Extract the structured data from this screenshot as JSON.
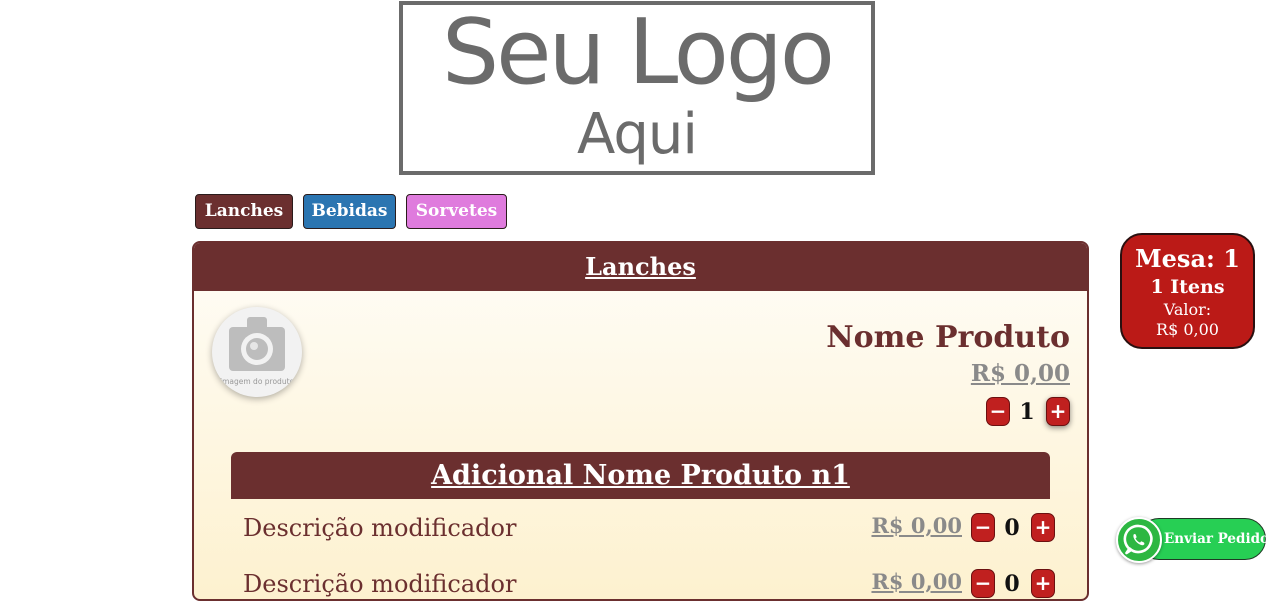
{
  "logo": {
    "line1": "Seu Logo",
    "line2": "Aqui"
  },
  "tabs": [
    {
      "label": "Lanches",
      "color": "#6b2f2f"
    },
    {
      "label": "Bebidas",
      "color": "#2b75b1"
    },
    {
      "label": "Sorvetes",
      "color": "#df7bdd"
    }
  ],
  "section": {
    "title": "Lanches"
  },
  "product": {
    "image_caption": "Imagem do produto",
    "name": "Nome Produto",
    "price": "R$ 0,00",
    "quantity": "1"
  },
  "addon": {
    "title": "Adicional Nome Produto n1",
    "modifiers": [
      {
        "description": "Descrição modificador",
        "price": "R$ 0,00",
        "quantity": "0"
      },
      {
        "description": "Descrição modificador",
        "price": "R$ 0,00",
        "quantity": "0"
      }
    ]
  },
  "mesa": {
    "title": "Mesa: 1",
    "items": "1 Itens",
    "value_label": "Valor:",
    "value": "R$ 0,00"
  },
  "whatsapp": {
    "label": "Enviar Pedido"
  },
  "controls": {
    "minus": "−",
    "plus": "+"
  },
  "colors": {
    "brand": "#6b2f2f",
    "danger": "#c0201f",
    "whatsapp": "#27cf54"
  }
}
